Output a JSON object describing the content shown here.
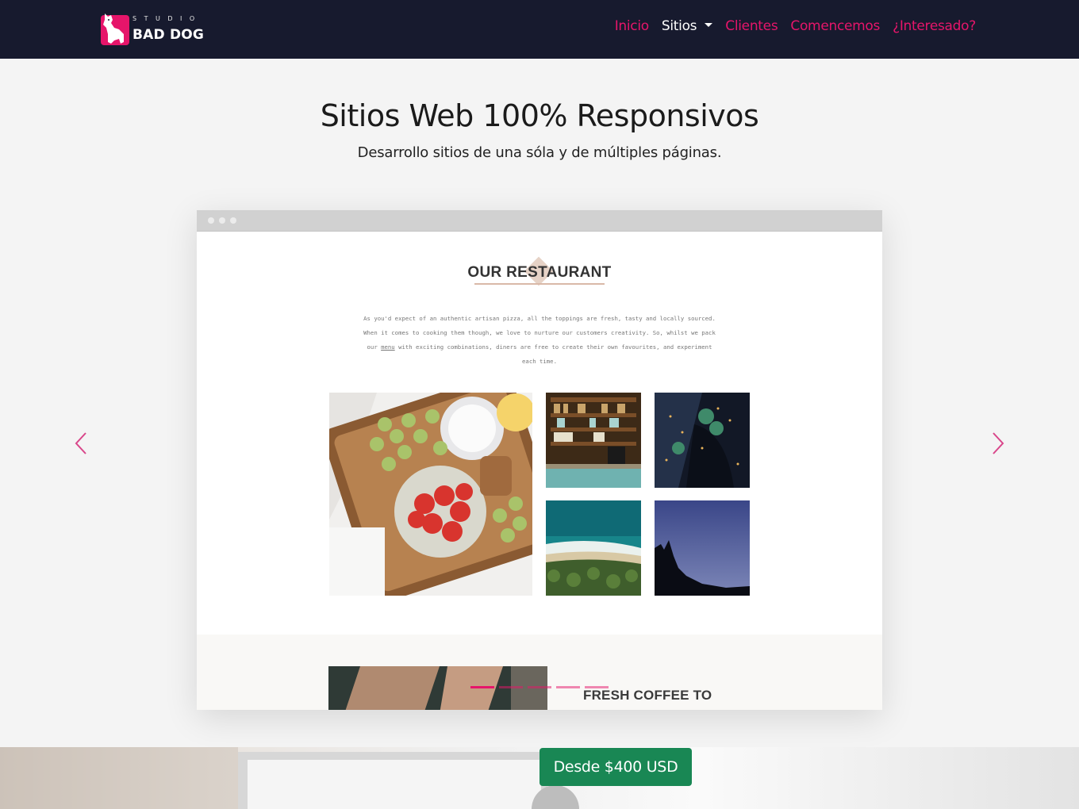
{
  "brand": {
    "studio": "STUDIO",
    "name": "BAD DOG"
  },
  "nav": {
    "items": [
      {
        "label": "Inicio",
        "active": false
      },
      {
        "label": "Sitios",
        "active": true,
        "dropdown": true
      },
      {
        "label": "Clientes",
        "active": false
      },
      {
        "label": "Comencemos",
        "active": false
      },
      {
        "label": "¿Interesado?",
        "active": false
      }
    ]
  },
  "hero": {
    "title": "Sitios Web 100% Responsivos",
    "subtitle": "Desarrollo sitios de una sóla y de múltiples páginas."
  },
  "carousel": {
    "slide": {
      "site_title": "OUR RESTAURANT",
      "text_part1": "As you'd expect of an authentic artisan pizza, all the toppings are fresh, tasty and locally sourced. When it comes to cooking them though, we love to nurture our customers creativity. So, whilst we pack our ",
      "text_link": "menu",
      "text_part2": " with exciting combinations, diners are free to create their own favourites, and experiment each time.",
      "section2_title": "FRESH COFFEE TO"
    },
    "indicator_count": 6,
    "active_indicator": 0
  },
  "cta": {
    "price_label": "Desde $400 USD"
  },
  "colors": {
    "nav_bg": "#171a2e",
    "accent": "#e6156a",
    "cta": "#198754",
    "page_bg": "#f4f4f4"
  },
  "icons": {
    "prev": "chevron-left-icon",
    "next": "chevron-right-icon",
    "logo": "dog-logo-icon"
  }
}
